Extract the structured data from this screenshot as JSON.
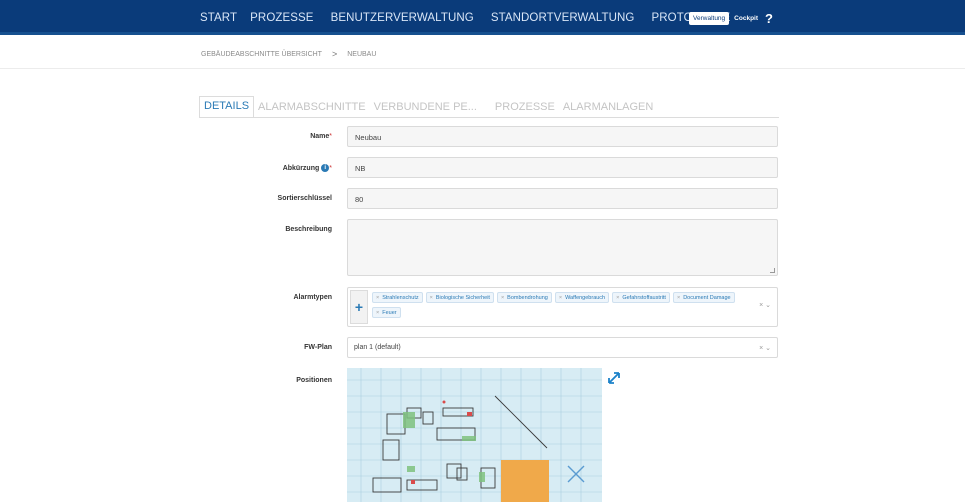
{
  "nav": {
    "items": [
      "START",
      "PROZESSE",
      "BENUTZERVERWALTUNG",
      "STANDORTVERWALTUNG",
      "PROTOKOLLE"
    ],
    "mode_active": "Verwaltung",
    "mode_other": "Cockpit",
    "help": "?"
  },
  "breadcrumb": {
    "parent": "GEBÄUDEABSCHNITTE ÜBERSICHT",
    "separator": ">",
    "current": "NEUBAU"
  },
  "tabs": [
    "DETAILS",
    "ALARMABSCHNITTE",
    "VERBUNDENE PE...",
    "PROZESSE",
    "ALARMANLAGEN"
  ],
  "form": {
    "name_label": "Name",
    "name_value": "Neubau",
    "abk_label": "Abkürzung",
    "abk_value": "NB",
    "sort_label": "Sortierschlüssel",
    "sort_value": "80",
    "desc_label": "Beschreibung",
    "desc_value": "",
    "alarm_label": "Alarmtypen",
    "alarm_types": [
      "Strahlenschutz",
      "Biologische Sicherheit",
      "Bombendrohung",
      "Waffengebrauch",
      "Gefahrstoffaustritt",
      "Document Damage",
      "Feuer"
    ],
    "fw_label": "FW-Plan",
    "fw_value": "plan 1 (default)",
    "pos_label": "Positionen",
    "required_mark": "*"
  },
  "icons": {
    "info": "info-icon",
    "add": "plus-icon",
    "clear": "close-icon",
    "dropdown": "chevron-down-icon",
    "expand": "expand-icon"
  },
  "colors": {
    "navbar": "#0a3b7a",
    "accent": "#2a7ab5",
    "map_bg": "#d7ecf4",
    "map_highlight": "#f0a94a"
  }
}
